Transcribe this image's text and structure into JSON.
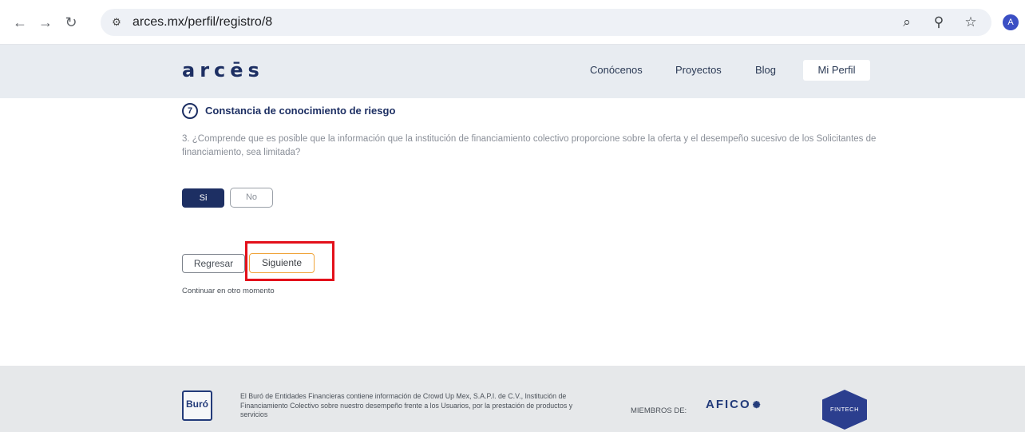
{
  "browser": {
    "url": "arces.mx/perfil/registro/8",
    "profile_initial": "A"
  },
  "header": {
    "logo": "arcēs",
    "nav": [
      "Conócenos",
      "Proyectos",
      "Blog"
    ],
    "profile_link": "Mi Perfil"
  },
  "step": {
    "number": "7",
    "title": "Constancia de conocimiento de riesgo",
    "question": "3. ¿Comprende que es posible que la información que la institución de financiamiento colectivo proporcione sobre la oferta y el desempeño sucesivo de los Solicitantes de financiamiento, sea limitada?",
    "option_yes": "Si",
    "option_no": "No",
    "selected": "Si"
  },
  "actions": {
    "back": "Regresar",
    "next": "Siguiente",
    "later": "Continuar en otro momento"
  },
  "footer": {
    "buro_label": "Buró",
    "disclaimer": "El Buró de Entidades Financieras contiene información de Crowd Up Mex, S.A.P.I. de C.V., Institución de Financiamiento Colectivo sobre nuestro desempeño frente a los Usuarios, por la prestación de productos y servicios",
    "members_label": "MIEMBROS DE:",
    "afico": "AFICO",
    "fintech": "FINTECH"
  },
  "colors": {
    "brand_navy": "#1d2f63",
    "highlight_red": "#e3101a",
    "next_border": "#f0a53c"
  }
}
